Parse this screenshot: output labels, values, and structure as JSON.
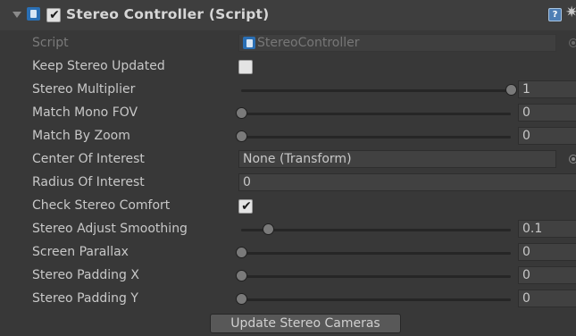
{
  "component": {
    "title": "Stereo Controller (Script)",
    "enabled": true,
    "foldout_expanded": true
  },
  "icons": {
    "foldout": "triangle-down-icon",
    "script": "script-icon",
    "help": "help-icon",
    "settings": "gear-icon",
    "object_picker": "object-picker-icon"
  },
  "help_glyph": "?",
  "gear_glyph": "✷",
  "check_glyph": "✔",
  "fields": {
    "script": {
      "label": "Script",
      "value": "StereoController"
    },
    "keep_stereo_updated": {
      "label": "Keep Stereo Updated",
      "checked": false
    },
    "stereo_multiplier": {
      "label": "Stereo Multiplier",
      "value": "1",
      "fraction": 1.0
    },
    "match_mono_fov": {
      "label": "Match Mono FOV",
      "value": "0",
      "fraction": 0.0
    },
    "match_by_zoom": {
      "label": "Match By Zoom",
      "value": "0",
      "fraction": 0.0
    },
    "center_of_interest": {
      "label": "Center Of Interest",
      "value": "None (Transform)"
    },
    "radius_of_interest": {
      "label": "Radius Of Interest",
      "value": "0"
    },
    "check_stereo_comfort": {
      "label": "Check Stereo Comfort",
      "checked": true
    },
    "stereo_adjust_smoothing": {
      "label": "Stereo Adjust Smoothing",
      "value": "0.1",
      "fraction": 0.1
    },
    "screen_parallax": {
      "label": "Screen Parallax",
      "value": "0",
      "fraction": 0.0
    },
    "stereo_padding_x": {
      "label": "Stereo Padding X",
      "value": "0",
      "fraction": 0.0
    },
    "stereo_padding_y": {
      "label": "Stereo Padding Y",
      "value": "0",
      "fraction": 0.0
    }
  },
  "buttons": {
    "update_stereo_cameras": "Update Stereo Cameras"
  },
  "colors": {
    "background": "#383838",
    "header": "#3e3e3e",
    "script_icon": "#2a6fb4",
    "text": "#c8c8c8"
  }
}
